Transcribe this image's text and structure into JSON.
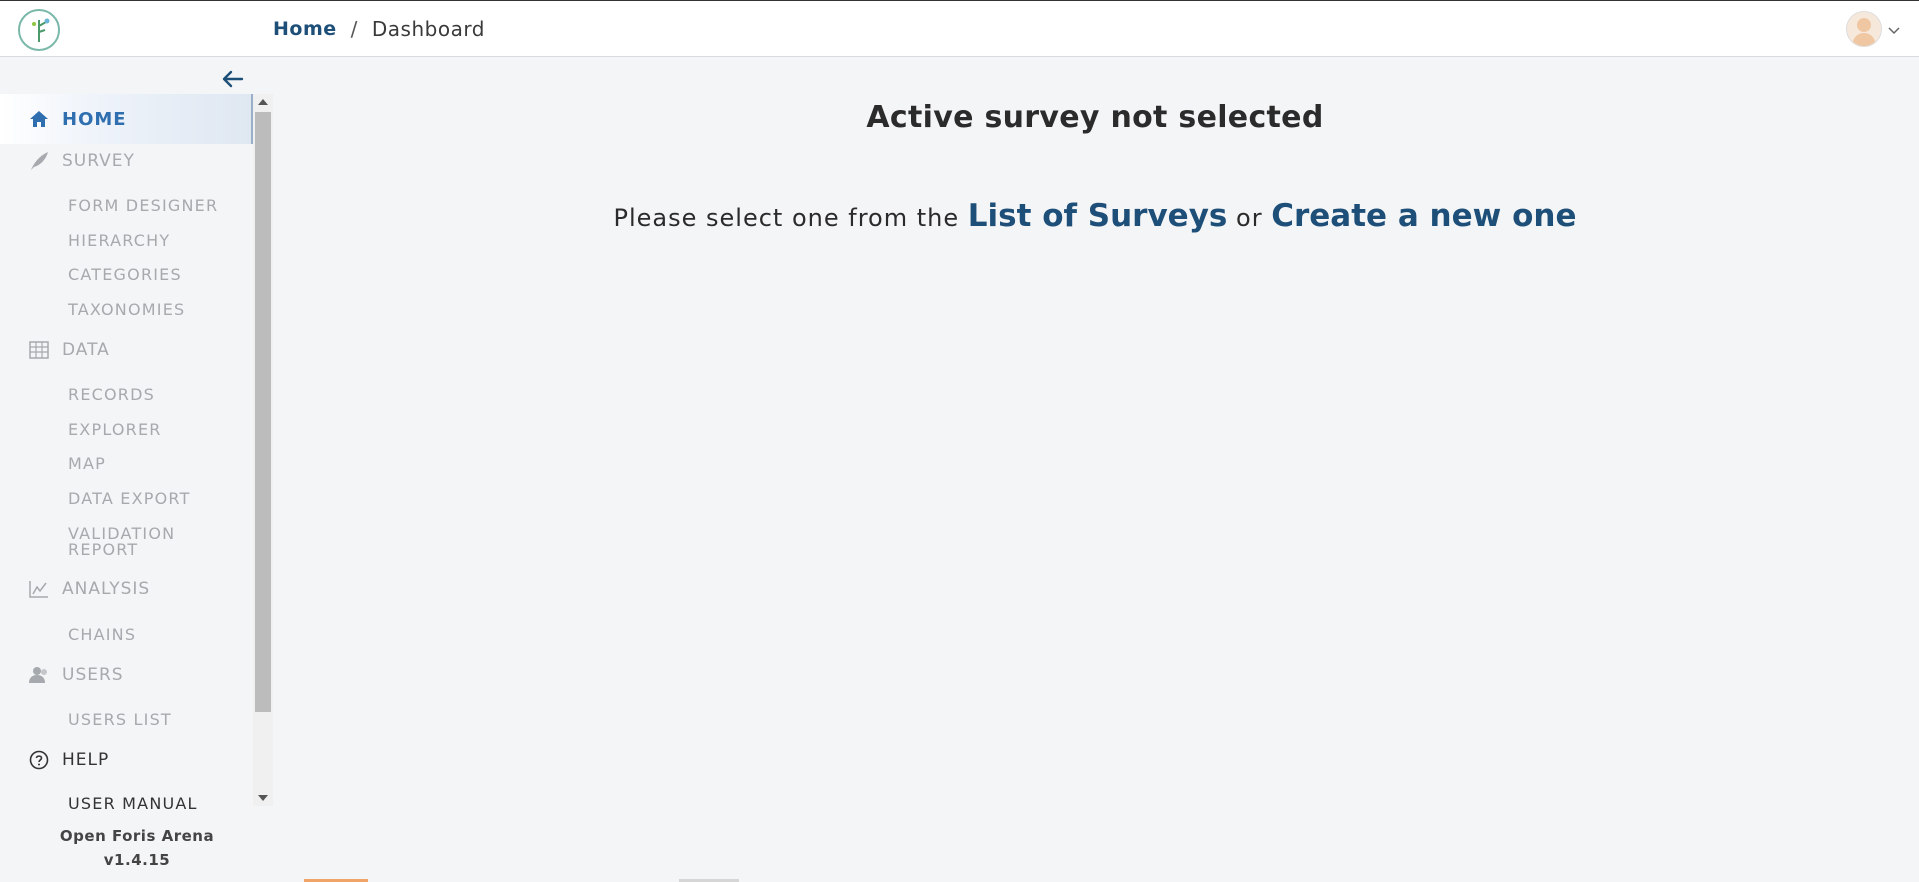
{
  "header": {
    "breadcrumb": {
      "home": "Home",
      "separator": "/",
      "current": "Dashboard"
    },
    "logo_icon": "open-foris-tree-logo",
    "user_icon": "user-avatar-icon",
    "user_menu_icon": "chevron-down-icon"
  },
  "sidebar": {
    "collapse_icon": "arrow-left-icon",
    "sections": [
      {
        "label": "HOME",
        "icon": "home-icon",
        "active": true,
        "items": []
      },
      {
        "label": "SURVEY",
        "icon": "feather-icon",
        "items": [
          "FORM DESIGNER",
          "HIERARCHY",
          "CATEGORIES",
          "TAXONOMIES"
        ]
      },
      {
        "label": "DATA",
        "icon": "table-icon",
        "items": [
          "RECORDS",
          "EXPLORER",
          "MAP",
          "DATA EXPORT",
          "VALIDATION REPORT"
        ]
      },
      {
        "label": "ANALYSIS",
        "icon": "chart-line-icon",
        "items": [
          "CHAINS"
        ]
      },
      {
        "label": "USERS",
        "icon": "users-icon",
        "items": [
          "USERS LIST"
        ]
      },
      {
        "label": "HELP",
        "icon": "question-circle-icon",
        "items": [
          "USER MANUAL"
        ]
      }
    ],
    "validation_report_lines": [
      "VALIDATION",
      "REPORT"
    ],
    "app_name": "Open Foris Arena",
    "version": "v1.4.15"
  },
  "main": {
    "title": "Active survey not selected",
    "message_prefix": "Please select one from the",
    "list_link": "List of Surveys",
    "message_or": "or",
    "create_link": "Create a new one"
  },
  "colors": {
    "brand_dark_blue": "#1d4f78",
    "active_blue": "#2f6fb0",
    "inactive_gray": "#a6a9ad",
    "background": "#f4f5f7"
  }
}
